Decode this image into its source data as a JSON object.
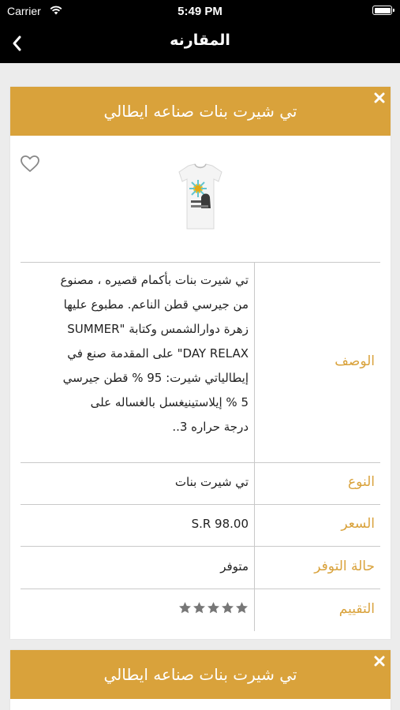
{
  "status_bar": {
    "carrier": "Carrier",
    "time": "5:49 PM"
  },
  "nav": {
    "title": "المقارنه",
    "back_icon": "chevron-left-icon"
  },
  "cards": [
    {
      "title": "تي شيرت بنات صناعه ايطالي",
      "details": {
        "description_label": "الوصف",
        "description_lines": [
          "تي شيرت بنات بأكمام قصيره ، مصنوع",
          "من جيرسي قطن الناعم. مطبوع عليها",
          "زهرة دوارالشمس وكتابة \"SUMMER",
          "DAY RELAX\" على المقدمة صنع في",
          "إيطالياتي شيرت: 95 % قطن جيرسي",
          "5 % إيلاستينيغسل بالغساله على",
          "درجة حراره 3.."
        ],
        "type_label": "النوع",
        "type_value": "تي شيرت بنات",
        "price_label": "السعر",
        "price_value": "S.R 98.00",
        "availability_label": "حالة التوفر",
        "availability_value": "متوفر",
        "rating_label": "التقييم",
        "rating_value": 5,
        "rating_max": 5
      }
    },
    {
      "title": "تي شيرت بنات صناعه ايطالي"
    }
  ],
  "colors": {
    "accent": "#d9a23b",
    "topbar": "#000000",
    "background": "#ececec",
    "star": "#777777"
  }
}
